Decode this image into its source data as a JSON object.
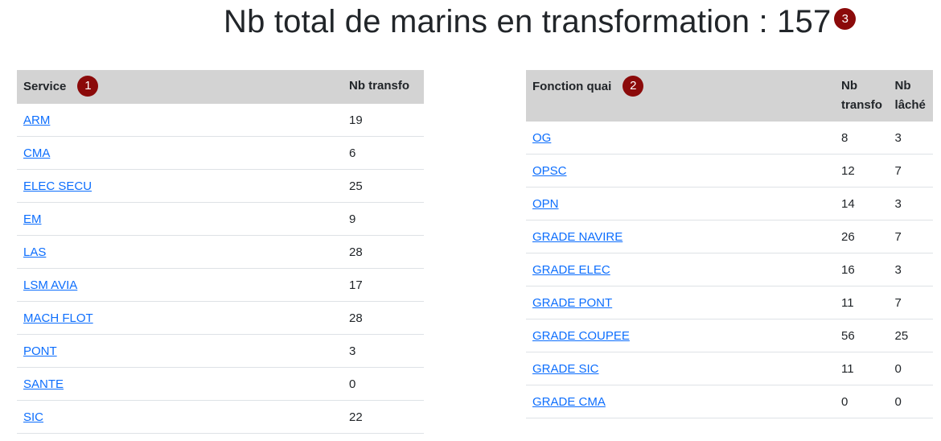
{
  "title": {
    "text": "Nb total de marins en transformation : 157",
    "badge": "3"
  },
  "services": {
    "header": {
      "service": "Service",
      "nb_transfo": "Nb transfo",
      "badge": "1"
    },
    "rows": [
      {
        "name": "ARM",
        "nb": "19"
      },
      {
        "name": "CMA",
        "nb": "6"
      },
      {
        "name": "ELEC SECU",
        "nb": "25"
      },
      {
        "name": "EM",
        "nb": "9"
      },
      {
        "name": "LAS",
        "nb": "28"
      },
      {
        "name": "LSM AVIA",
        "nb": "17"
      },
      {
        "name": "MACH FLOT",
        "nb": "28"
      },
      {
        "name": "PONT",
        "nb": "3"
      },
      {
        "name": "SANTE",
        "nb": "0"
      },
      {
        "name": "SIC",
        "nb": "22"
      }
    ]
  },
  "fonctions": {
    "header": {
      "fonction": "Fonction quai",
      "nb_transfo": "Nb transfo",
      "nb_lache": "Nb lâché",
      "badge": "2"
    },
    "rows": [
      {
        "name": "OG",
        "nb_transfo": "8",
        "nb_lache": "3"
      },
      {
        "name": "OPSC",
        "nb_transfo": "12",
        "nb_lache": "7"
      },
      {
        "name": "OPN",
        "nb_transfo": "14",
        "nb_lache": "3"
      },
      {
        "name": "GRADE NAVIRE",
        "nb_transfo": "26",
        "nb_lache": "7"
      },
      {
        "name": "GRADE ELEC",
        "nb_transfo": "16",
        "nb_lache": "3"
      },
      {
        "name": "GRADE PONT",
        "nb_transfo": "11",
        "nb_lache": "7"
      },
      {
        "name": "GRADE COUPEE",
        "nb_transfo": "56",
        "nb_lache": "25"
      },
      {
        "name": "GRADE SIC",
        "nb_transfo": "11",
        "nb_lache": "0"
      },
      {
        "name": "GRADE CMA",
        "nb_transfo": "0",
        "nb_lache": "0"
      }
    ]
  },
  "colors": {
    "badge": "#8b0a0a",
    "header_bg": "#d3d3d3",
    "link": "#0d6efd"
  }
}
